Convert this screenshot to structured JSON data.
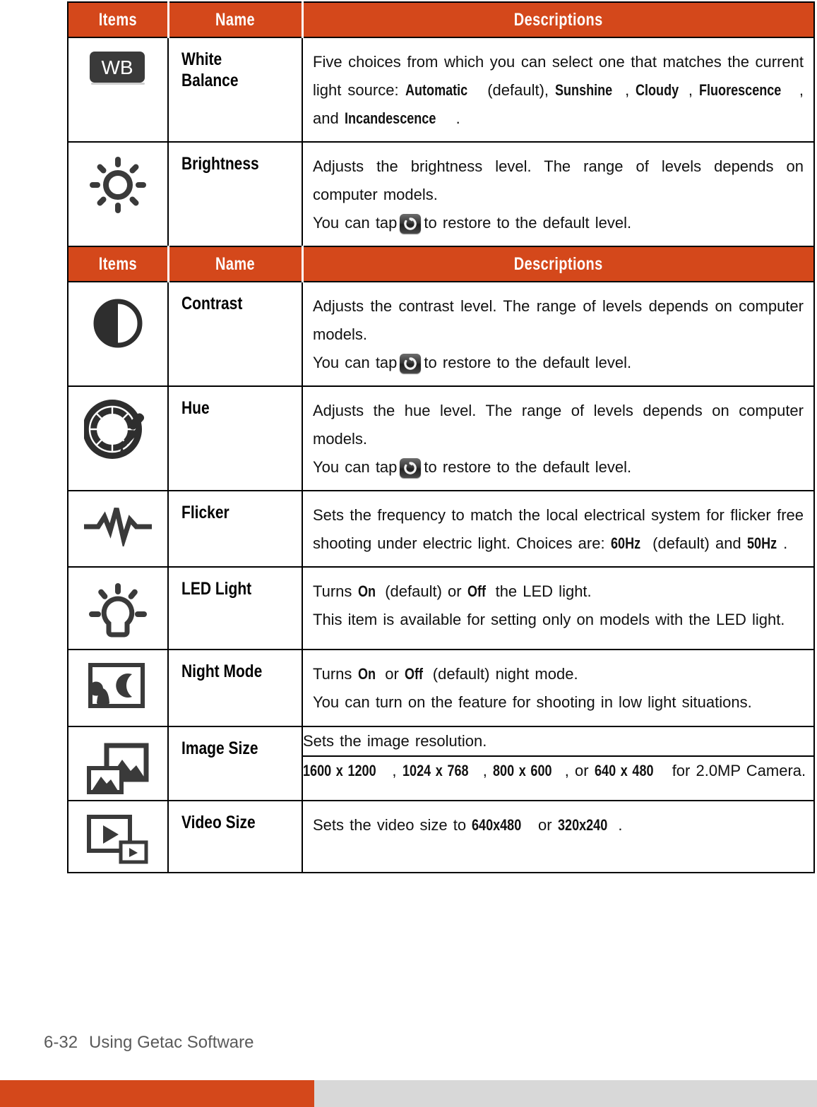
{
  "table": {
    "headers": {
      "items": "Items",
      "name": "Name",
      "descriptions": "Descriptions"
    },
    "rows": [
      {
        "icon": "white-balance-wb-icon",
        "name": "White\nBalance",
        "desc_parts": [
          {
            "t": "Five  choices  from  which  you  can  select  one  that  matches  the  current  light  source: ",
            "b": false
          },
          {
            "t": "Automatic",
            "b": true
          },
          {
            "t": " (default), ",
            "b": false
          },
          {
            "t": "Sunshine",
            "b": true
          },
          {
            "t": ", ",
            "b": false
          },
          {
            "t": "Cloudy",
            "b": true
          },
          {
            "t": ",  ",
            "b": false
          },
          {
            "t": "Fluorescence",
            "b": true
          },
          {
            "t": ",  and ",
            "b": false
          },
          {
            "t": "Incandescence",
            "b": true
          },
          {
            "t": ".",
            "b": false
          }
        ]
      },
      {
        "icon": "brightness-sun-icon",
        "name": "Brightness",
        "line1": "Adjusts  the  brightness  level.  The  range  of  levels  depends  on  computer  models.",
        "line2a": "You  can  tap",
        "line2b": "to  restore  to  the  default  level."
      },
      {
        "icon": "contrast-icon",
        "name": "Contrast",
        "line1": "Adjusts  the  contrast  level.  The  range  of  levels  depends  on  computer  models.",
        "line2a": "You  can  tap",
        "line2b": "to  restore  to  the  default  level."
      },
      {
        "icon": "hue-color-wheel-eyedropper-icon",
        "name": "Hue",
        "line1": "Adjusts  the  hue  level.  The  range  of  levels  depends  on  computer  models.",
        "line2a": "You  can  tap",
        "line2b": "to  restore  to  the  default  level."
      },
      {
        "icon": "flicker-waveform-icon",
        "name": "Flicker",
        "desc_parts": [
          {
            "t": "Sets  the  frequency  to  match  the  local  electrical  system  for  flicker  free  shooting  under  electric  light.  Choices  are: ",
            "b": false
          },
          {
            "t": "60Hz",
            "b": true
          },
          {
            "t": " (default)  and ",
            "b": false
          },
          {
            "t": "50Hz",
            "b": true
          },
          {
            "t": ".",
            "b": false
          }
        ]
      },
      {
        "icon": "led-light-bulb-icon",
        "name": "LED Light",
        "desc_parts_line1": [
          {
            "t": "Turns  ",
            "b": false
          },
          {
            "t": "On",
            "b": true
          },
          {
            "t": " (default)  or  ",
            "b": false
          },
          {
            "t": "Off",
            "b": true
          },
          {
            "t": "  the  LED  light.",
            "b": false
          }
        ],
        "line2": "This  item  is  available  for  setting  only  on  models  with  the  LED  light."
      },
      {
        "icon": "night-mode-moon-icon",
        "name": "Night Mode",
        "desc_parts_line1": [
          {
            "t": "Turns  ",
            "b": false
          },
          {
            "t": "On",
            "b": true
          },
          {
            "t": "  or  ",
            "b": false
          },
          {
            "t": "Off",
            "b": true
          },
          {
            "t": " (default)   night  mode.",
            "b": false
          }
        ],
        "line2": "You  can  turn  on  the  feature  for  shooting  in  low  light  situations."
      },
      {
        "icon": "image-size-pictures-icon",
        "name": "Image Size",
        "sub_line1": "Sets  the  image  resolution.",
        "sub_parts": [
          {
            "t": "1600 x 1200",
            "b": true
          },
          {
            "t": ",  ",
            "b": false
          },
          {
            "t": "1024 x 768",
            "b": true
          },
          {
            "t": ",  ",
            "b": false
          },
          {
            "t": "800 x 600",
            "b": true
          },
          {
            "t": ",  or  ",
            "b": false
          },
          {
            "t": "640 x 480",
            "b": true
          },
          {
            "t": " for  2.0MP  Camera.",
            "b": false
          }
        ]
      },
      {
        "icon": "video-size-play-icon",
        "name": "Video Size",
        "desc_parts": [
          {
            "t": "Sets  the  video  size  to  ",
            "b": false
          },
          {
            "t": "640x480",
            "b": true
          },
          {
            "t": " or  ",
            "b": false
          },
          {
            "t": "320x240",
            "b": true
          },
          {
            "t": ".",
            "b": false
          }
        ]
      }
    ]
  },
  "footer": {
    "page_number": "6-32",
    "section_title": "Using Getac Software"
  },
  "colors": {
    "accent_orange": "#D4481B",
    "footer_grey": "#d8d8d8",
    "text_grey": "#5a5a5a"
  }
}
